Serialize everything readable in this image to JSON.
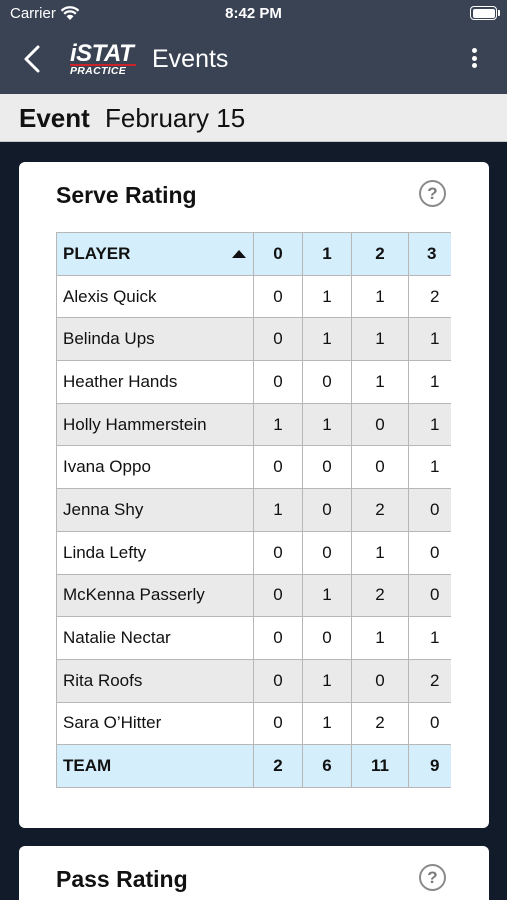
{
  "status": {
    "carrier": "Carrier",
    "time": "8:42 PM"
  },
  "nav": {
    "logo_line1": "iSTAT",
    "logo_line2": "PRACTICE",
    "title": "Events"
  },
  "event": {
    "label": "Event",
    "date": "February 15"
  },
  "serve_card": {
    "title": "Serve Rating",
    "help": "?",
    "columns": [
      "PLAYER",
      "0",
      "1",
      "2",
      "3"
    ],
    "rows": [
      {
        "name": "Alexis Quick",
        "v": [
          "0",
          "1",
          "1",
          "2"
        ]
      },
      {
        "name": "Belinda Ups",
        "v": [
          "0",
          "1",
          "1",
          "1"
        ]
      },
      {
        "name": "Heather Hands",
        "v": [
          "0",
          "0",
          "1",
          "1"
        ]
      },
      {
        "name": "Holly Hammerstein",
        "v": [
          "1",
          "1",
          "0",
          "1"
        ]
      },
      {
        "name": "Ivana Oppo",
        "v": [
          "0",
          "0",
          "0",
          "1"
        ]
      },
      {
        "name": "Jenna Shy",
        "v": [
          "1",
          "0",
          "2",
          "0"
        ]
      },
      {
        "name": "Linda Lefty",
        "v": [
          "0",
          "0",
          "1",
          "0"
        ]
      },
      {
        "name": "McKenna Passerly",
        "v": [
          "0",
          "1",
          "2",
          "0"
        ]
      },
      {
        "name": "Natalie Nectar",
        "v": [
          "0",
          "0",
          "1",
          "1"
        ]
      },
      {
        "name": "Rita Roofs",
        "v": [
          "0",
          "1",
          "0",
          "2"
        ]
      },
      {
        "name": "Sara O’Hitter",
        "v": [
          "0",
          "1",
          "2",
          "0"
        ]
      }
    ],
    "team": {
      "name": "TEAM",
      "v": [
        "2",
        "6",
        "11",
        "9"
      ]
    }
  },
  "pass_card": {
    "title": "Pass Rating",
    "help": "?"
  }
}
